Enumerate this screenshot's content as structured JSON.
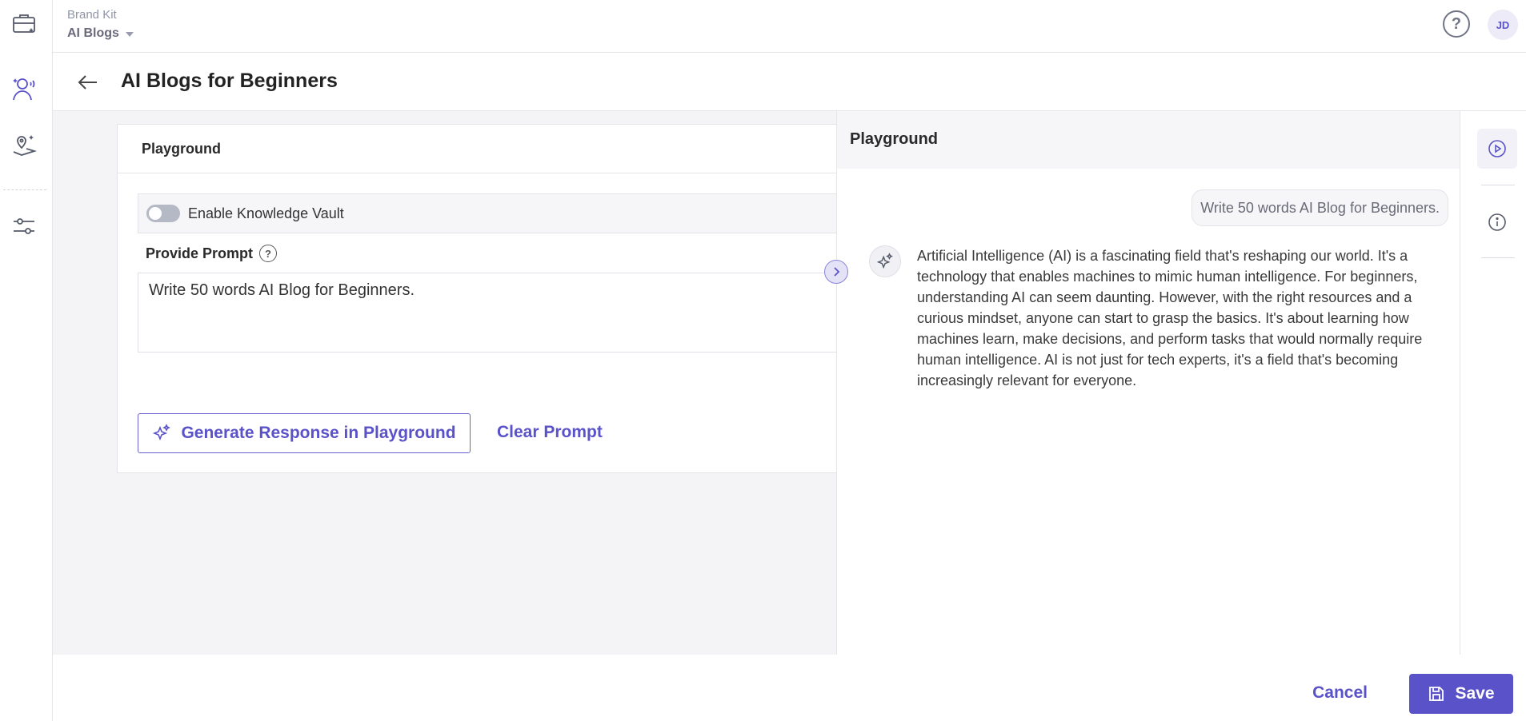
{
  "header": {
    "breadcrumb_label": "Brand Kit",
    "breadcrumb_current": "AI Blogs",
    "help_icon": "?",
    "avatar_initials": "JD"
  },
  "page": {
    "title": "AI Blogs for Beginners"
  },
  "sidebar": {
    "items": [
      {
        "icon": "briefcase-icon"
      },
      {
        "icon": "voice-persona-icon"
      },
      {
        "icon": "location-magic-icon"
      },
      {
        "icon": "sliders-icon"
      }
    ]
  },
  "editor": {
    "card_title": "Playground",
    "vault_label": "Enable Knowledge Vault",
    "vault_enabled": false,
    "prompt_label": "Provide Prompt",
    "prompt_value": "Write 50 words AI Blog for Beginners.",
    "generate_label": "Generate Response in Playground",
    "clear_label": "Clear Prompt"
  },
  "playground": {
    "title": "Playground",
    "user_message": "Write 50 words AI Blog for Beginners.",
    "ai_response": "Artificial Intelligence (AI) is a fascinating field that's reshaping our world. It's a technology that enables machines to mimic human intelligence. For beginners, understanding AI can seem daunting. However, with the right resources and a curious mindset, anyone can start to grasp the basics. It's about learning how machines learn, make decisions, and perform tasks that would normally require human intelligence. AI is not just for tech experts, it's a field that's becoming increasingly relevant for everyone."
  },
  "footer": {
    "cancel_label": "Cancel",
    "save_label": "Save"
  },
  "colors": {
    "accent": "#5a52c9",
    "background_main": "#f4f4f7"
  }
}
